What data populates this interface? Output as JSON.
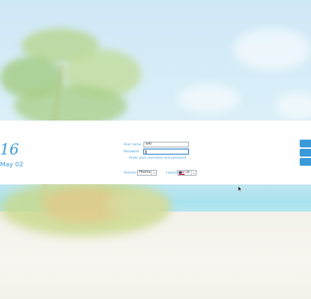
{
  "clock": {
    "time": "16",
    "date": "May 02"
  },
  "login": {
    "username_label": "User name:",
    "username_value": "wiki",
    "password_label": "Password:",
    "password_value": "",
    "hint": "Enter your username and password"
  },
  "session": {
    "label": "Session:",
    "value": "Plasma"
  },
  "layout": {
    "label": "Layout:",
    "value": "us"
  },
  "colors": {
    "accent": "#3a9ad9",
    "band": "#ffffff"
  }
}
